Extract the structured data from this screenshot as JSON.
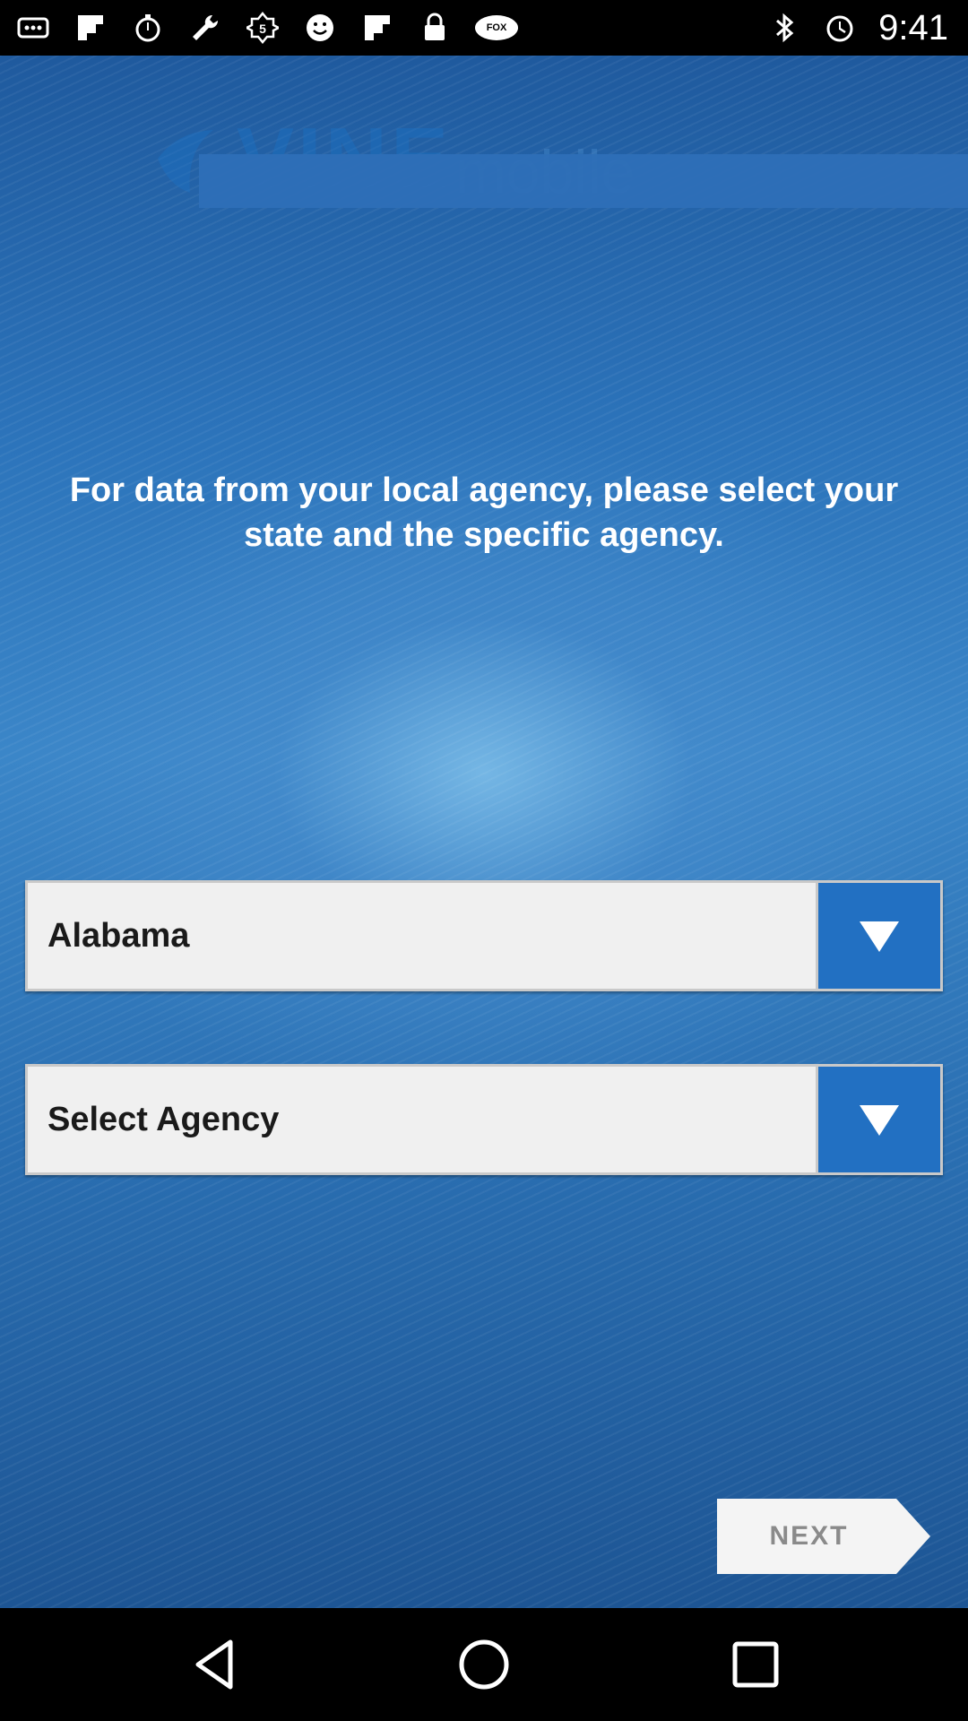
{
  "status_bar": {
    "time": "9:41",
    "left_icons": [
      "more-icon",
      "flipboard-icon",
      "stopwatch-icon",
      "wrench-icon",
      "badge-5-icon",
      "smiley-icon",
      "flipboard-icon",
      "lock-icon",
      "fox-sports-icon"
    ],
    "right_icons": [
      "bluetooth-icon",
      "alarm-icon"
    ],
    "fox_badge_text": "FOX"
  },
  "app": {
    "logo": {
      "main_text": "VINE",
      "sub_text": "mobile"
    },
    "instruction": "For data from your local agency, please select your state and the specific agency.",
    "state_dropdown": {
      "selected": "Alabama"
    },
    "agency_dropdown": {
      "selected": "Select Agency"
    },
    "next_button": {
      "label": "NEXT"
    }
  },
  "nav_bar": {
    "buttons": [
      "back-icon",
      "home-icon",
      "recent-apps-icon"
    ]
  },
  "colors": {
    "accent_blue": "#2270c2",
    "dropdown_bg": "#f0f0f0",
    "text_dark": "#1a1a1a"
  }
}
